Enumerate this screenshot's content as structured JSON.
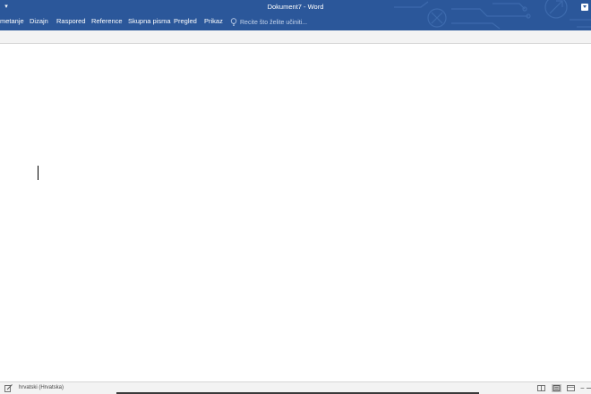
{
  "window": {
    "title": "Dokument7  -  Word"
  },
  "tabs": [
    {
      "label": "metanje"
    },
    {
      "label": "Dizajn"
    },
    {
      "label": "Raspored"
    },
    {
      "label": "Reference"
    },
    {
      "label": "Skupna pisma"
    },
    {
      "label": "Pregled"
    },
    {
      "label": "Prikaz"
    }
  ],
  "tell_me": {
    "placeholder": "Recite što želite učiniti..."
  },
  "status_bar": {
    "language": "hrvatski (Hrvatska)"
  },
  "colors": {
    "ribbon": "#2b579a",
    "status_bar": "#f3f3f3"
  },
  "icons": {
    "quick_access": "chevron-down-icon",
    "ribbon_display": "ribbon-display-icon",
    "tell_me": "lightbulb-icon",
    "proofing": "proofing-icon",
    "read_mode": "read-mode-icon",
    "print_layout": "print-layout-icon",
    "web_layout": "web-layout-icon"
  }
}
